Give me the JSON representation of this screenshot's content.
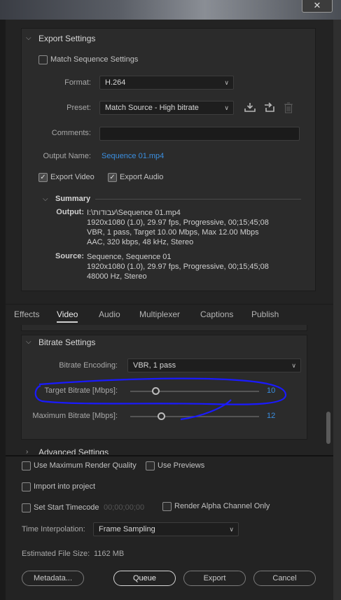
{
  "window": {
    "close_glyph": "✕"
  },
  "export_settings": {
    "title": "Export Settings",
    "match_sequence": "Match Sequence Settings",
    "format_label": "Format:",
    "format_value": "H.264",
    "preset_label": "Preset:",
    "preset_value": "Match Source - High bitrate",
    "comments_label": "Comments:",
    "comments_value": "",
    "output_name_label": "Output Name:",
    "output_name_value": "Sequence 01.mp4",
    "export_video": "Export Video",
    "export_audio": "Export Audio",
    "export_video_checked": true,
    "export_audio_checked": true,
    "match_sequence_checked": false
  },
  "summary": {
    "title": "Summary",
    "output_label": "Output:",
    "output_lines": [
      "I:\\עבודות\\Sequence 01.mp4",
      "1920x1080 (1.0), 29.97 fps, Progressive, 00;15;45;08",
      "VBR, 1 pass, Target 10.00 Mbps, Max 12.00 Mbps",
      "AAC, 320 kbps, 48 kHz, Stereo"
    ],
    "source_label": "Source:",
    "source_lines": [
      "Sequence, Sequence 01",
      "1920x1080 (1.0), 29.97 fps, Progressive, 00;15;45;08",
      "48000 Hz, Stereo"
    ]
  },
  "tabs": [
    {
      "label": "Effects",
      "active": false
    },
    {
      "label": "Video",
      "active": true
    },
    {
      "label": "Audio",
      "active": false
    },
    {
      "label": "Multiplexer",
      "active": false
    },
    {
      "label": "Captions",
      "active": false
    },
    {
      "label": "Publish",
      "active": false
    }
  ],
  "bitrate": {
    "title": "Bitrate Settings",
    "encoding_label": "Bitrate Encoding:",
    "encoding_value": "VBR, 1 pass",
    "target_label": "Target Bitrate [Mbps]:",
    "target_value": "10",
    "target_fraction": 0.2,
    "max_label": "Maximum Bitrate [Mbps]:",
    "max_value": "12",
    "max_fraction": 0.24,
    "advanced_title": "Advanced Settings"
  },
  "bottom": {
    "max_render": "Use Maximum Render Quality",
    "use_previews": "Use Previews",
    "import_project": "Import into project",
    "start_timecode": "Set Start Timecode",
    "timecode_value": "00;00;00;00",
    "render_alpha": "Render Alpha Channel Only",
    "time_interp_label": "Time Interpolation:",
    "time_interp_value": "Frame Sampling",
    "est_size_label": "Estimated File Size:",
    "est_size_value": "1162 MB"
  },
  "buttons": {
    "metadata": "Metadata...",
    "queue": "Queue",
    "export": "Export",
    "cancel": "Cancel"
  },
  "colors": {
    "accent": "#3b8fe0",
    "annotation": "#1a1aff"
  }
}
